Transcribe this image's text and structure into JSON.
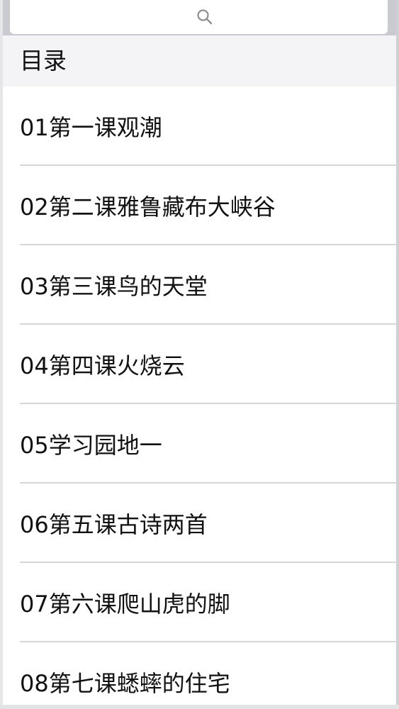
{
  "search": {
    "icon": "search-icon",
    "placeholder": ""
  },
  "section": {
    "title": "目录"
  },
  "lessons": [
    "01第一课观潮",
    "02第二课雅鲁藏布大峡谷",
    "03第三课鸟的天堂",
    "04第四课火烧云",
    "05学习园地一",
    "06第五课古诗两首",
    "07第六课爬山虎的脚",
    "08第七课蟋蟀的住宅"
  ],
  "colors": {
    "search_bar_bg": "#c9cbd1",
    "section_header_bg": "#f4f4f6",
    "separator": "#d6d6d8",
    "text": "#111111"
  }
}
